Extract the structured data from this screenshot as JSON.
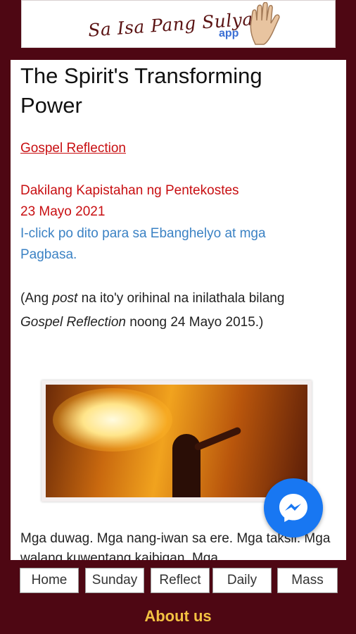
{
  "header": {
    "logo_text": "Sa Isa Pang Sulyap",
    "logo_app": "app"
  },
  "article": {
    "title": "The Spirit's Transforming Power",
    "section_link": "Gospel Reflection",
    "feast": "Dakilang Kapistahan ng Pentekostes",
    "date": "23 Mayo 2021",
    "readings_link": "I-click po dito para sa Ebanghelyo at mga Pagbasa.",
    "note_prefix": "(Ang ",
    "note_italic_1": "post",
    "note_middle": " na ito'y orihinal na inilathala bilang ",
    "note_italic_2": "Gospel Reflection",
    "note_suffix": " noong 24 Mayo 2015.)",
    "body": "Mga duwag. Mga nang-iwan sa ere. Mga taksil. Mga walang kuwentang kaibigan. Mga"
  },
  "nav": {
    "items": [
      "Home",
      "Sunday",
      "Reflect",
      "Daily",
      "Mass"
    ]
  },
  "footer": {
    "about_us": "About us"
  },
  "colors": {
    "background": "#4e0713",
    "accent_red": "#c80f12",
    "link_blue": "#3b82c4",
    "about_yellow": "#f3c242",
    "messenger_blue": "#1877f2"
  },
  "icons": {
    "logo_hand": "hand-icon",
    "messenger": "messenger-icon"
  }
}
